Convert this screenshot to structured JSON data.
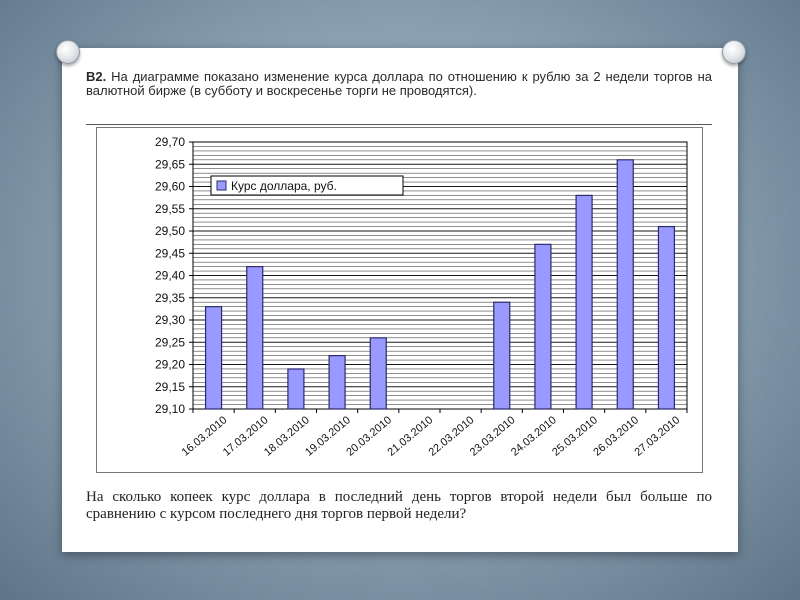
{
  "problem": {
    "label": "В2.",
    "text": "На диаграмме показано изменение курса доллара по отношению к рублю за 2 недели торгов на валютной бирже (в субботу и воскресенье торги не проводятся)."
  },
  "question": "На сколько копеек курс доллара в последний день торгов второй недели был больше по сравнению с курсом последнего дня торгов первой недели?",
  "chart_data": {
    "type": "bar",
    "title": "",
    "xlabel": "",
    "ylabel": "",
    "ylim": [
      29.1,
      29.7
    ],
    "y_ticks": [
      "29,10",
      "29,15",
      "29,20",
      "29,25",
      "29,30",
      "29,35",
      "29,40",
      "29,45",
      "29,50",
      "29,55",
      "29,60",
      "29,65",
      "29,70"
    ],
    "y_tick_values": [
      29.1,
      29.15,
      29.2,
      29.25,
      29.3,
      29.35,
      29.4,
      29.45,
      29.5,
      29.55,
      29.6,
      29.65,
      29.7
    ],
    "categories": [
      "16.03.2010",
      "17.03.2010",
      "18.03.2010",
      "19.03.2010",
      "20.03.2010",
      "21.03.2010",
      "22.03.2010",
      "23.03.2010",
      "24.03.2010",
      "25.03.2010",
      "26.03.2010",
      "27.03.2010"
    ],
    "bar_slots": 12,
    "series": [
      {
        "name": "Курс доллара, руб.",
        "values": [
          29.33,
          29.42,
          29.19,
          29.22,
          29.26,
          null,
          null,
          29.34,
          29.47,
          29.58,
          29.66,
          29.51
        ]
      }
    ],
    "grid": true,
    "legend": "top-left",
    "bar_color": "#9999ff",
    "bar_stroke": "#2b2b6b"
  }
}
